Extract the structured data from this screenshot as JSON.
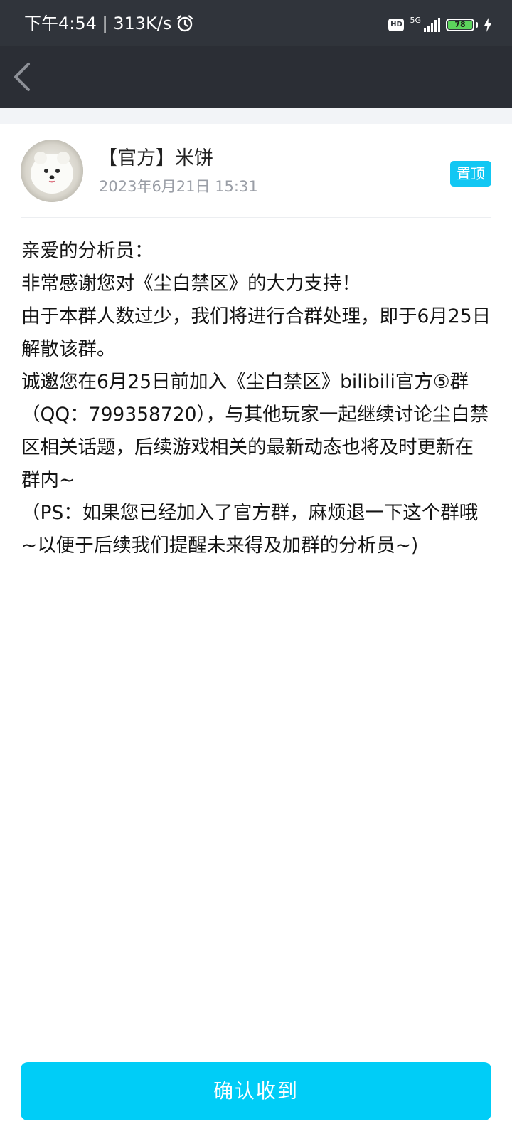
{
  "status_bar": {
    "time_speed": "下午4:54 | 313K/s",
    "hd_label": "HD",
    "network_label": "5G",
    "battery_level": "78",
    "icons": [
      "alarm-icon",
      "hd-icon",
      "signal-icon",
      "battery-icon",
      "charging-icon"
    ]
  },
  "nav": {
    "back_icon": "chevron-left-icon"
  },
  "message": {
    "sender": "【官方】米饼",
    "time": "2023年6月21日 15:31",
    "pin_label": "置顶",
    "paragraphs": [
      "亲爱的分析员：",
      "非常感谢您对《尘白禁区》的大力支持！",
      "由于本群人数过少，我们将进行合群处理，即于6月25日解散该群。",
      "诚邀您在6月25日前加入《尘白禁区》bilibili官方⑤群（QQ：799358720），与其他玩家一起继续讨论尘白禁区相关话题，后续游戏相关的最新动态也将及时更新在群内~",
      "（PS：如果您已经加入了官方群，麻烦退一下这个群哦~以便于后续我们提醒未来得及加群的分析员~)"
    ]
  },
  "confirm_label": "确认收到",
  "colors": {
    "status_bar_bg": "#30343b",
    "nav_bg": "#2b2e35",
    "accent": "#00cdf7",
    "pin_badge": "#12c7f3",
    "battery_fill": "#5cd35c"
  }
}
